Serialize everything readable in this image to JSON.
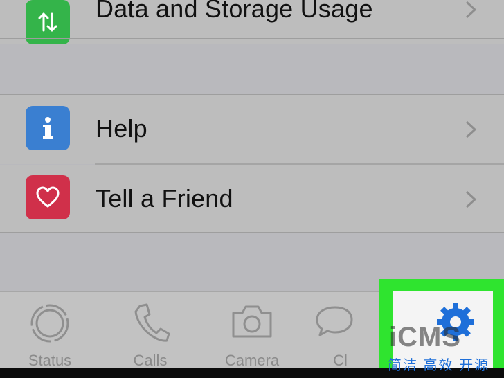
{
  "settings": {
    "data_row": {
      "label": "Data and Storage Usage",
      "icon": "arrows-up-down-icon",
      "color": "#34b44a"
    },
    "help_row": {
      "label": "Help",
      "icon": "info-icon",
      "color": "#3a7fd1"
    },
    "friend_row": {
      "label": "Tell a Friend",
      "icon": "heart-icon",
      "color": "#d0304a"
    }
  },
  "tabbar": {
    "tabs": [
      {
        "label": "Status",
        "icon": "status-ring-icon"
      },
      {
        "label": "Calls",
        "icon": "phone-icon"
      },
      {
        "label": "Camera",
        "icon": "camera-icon"
      },
      {
        "label": "Cl",
        "icon": "chat-bubbles-icon"
      },
      {
        "label": "",
        "icon": "gear-icon"
      }
    ]
  },
  "watermark": {
    "logo": "iCMS",
    "tagline": "简洁 高效 开源"
  },
  "colors": {
    "highlight": "#2fe42f",
    "background": "#b9b9bd",
    "selected_tab": "#1e6fd9"
  }
}
